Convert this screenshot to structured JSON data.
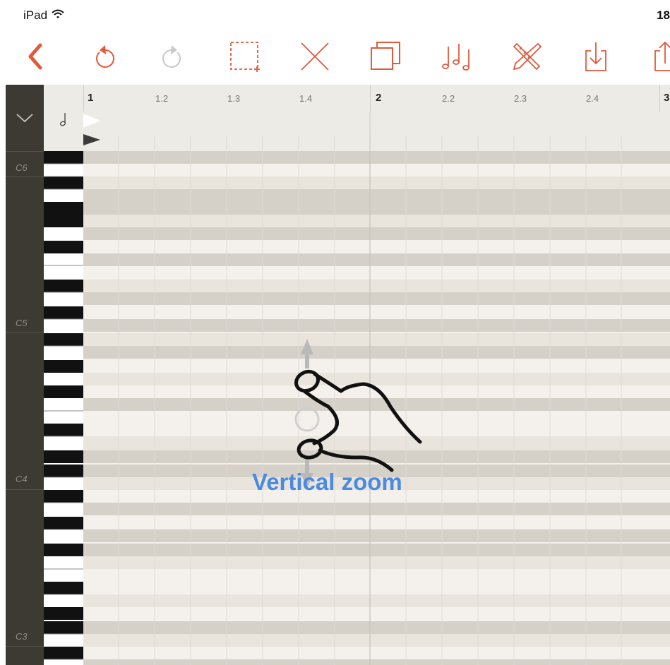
{
  "status": {
    "device": "iPad",
    "time": "18"
  },
  "toolbar": {
    "accent_color": "#e05a3c",
    "buttons": [
      {
        "name": "back-icon"
      },
      {
        "name": "undo-icon"
      },
      {
        "name": "redo-icon"
      },
      {
        "name": "marquee-select-icon"
      },
      {
        "name": "delete-icon"
      },
      {
        "name": "duplicate-icon"
      },
      {
        "name": "notes-icon"
      },
      {
        "name": "edit-tools-icon"
      },
      {
        "name": "import-icon"
      },
      {
        "name": "share-icon"
      }
    ]
  },
  "sidebar": {
    "octaves": [
      "C6",
      "C5",
      "C4",
      "C3"
    ]
  },
  "ruler": {
    "labels": [
      "1",
      "1.2",
      "1.3",
      "1.4",
      "2",
      "2.2",
      "2.3",
      "2.4",
      "3"
    ]
  },
  "overlay": {
    "label": "Vertical zoom"
  }
}
